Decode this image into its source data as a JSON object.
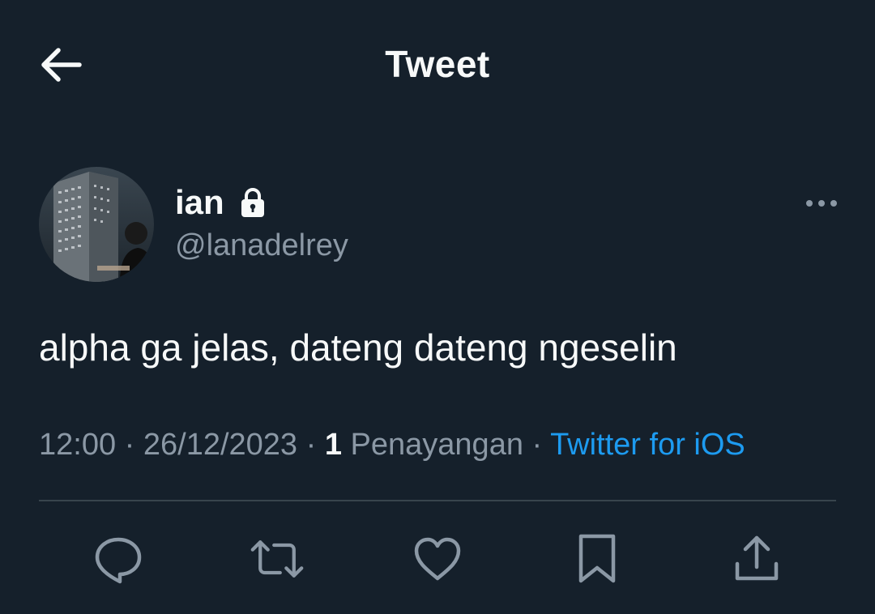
{
  "header": {
    "back_icon": "arrow-left-icon",
    "title": "Tweet"
  },
  "author": {
    "display_name": "ian",
    "protected_icon": "lock-icon",
    "handle": "@lanadelrey",
    "avatar_description": "profile photo"
  },
  "tweet": {
    "text": "alpha ga jelas, dateng dateng ngeselin",
    "time": "12:00",
    "date": "26/12/2023",
    "views_count": "1",
    "views_label": "Penayangan",
    "source": "Twitter for iOS",
    "separator": "·"
  },
  "actions": [
    {
      "name": "reply",
      "icon": "reply-icon"
    },
    {
      "name": "retweet",
      "icon": "retweet-icon"
    },
    {
      "name": "like",
      "icon": "heart-icon"
    },
    {
      "name": "bookmark",
      "icon": "bookmark-icon"
    },
    {
      "name": "share",
      "icon": "share-icon"
    }
  ],
  "colors": {
    "background": "#15202b",
    "text_primary": "#f7f9f9",
    "text_secondary": "#8b98a5",
    "accent": "#1d9bf0",
    "divider": "#38444d"
  }
}
